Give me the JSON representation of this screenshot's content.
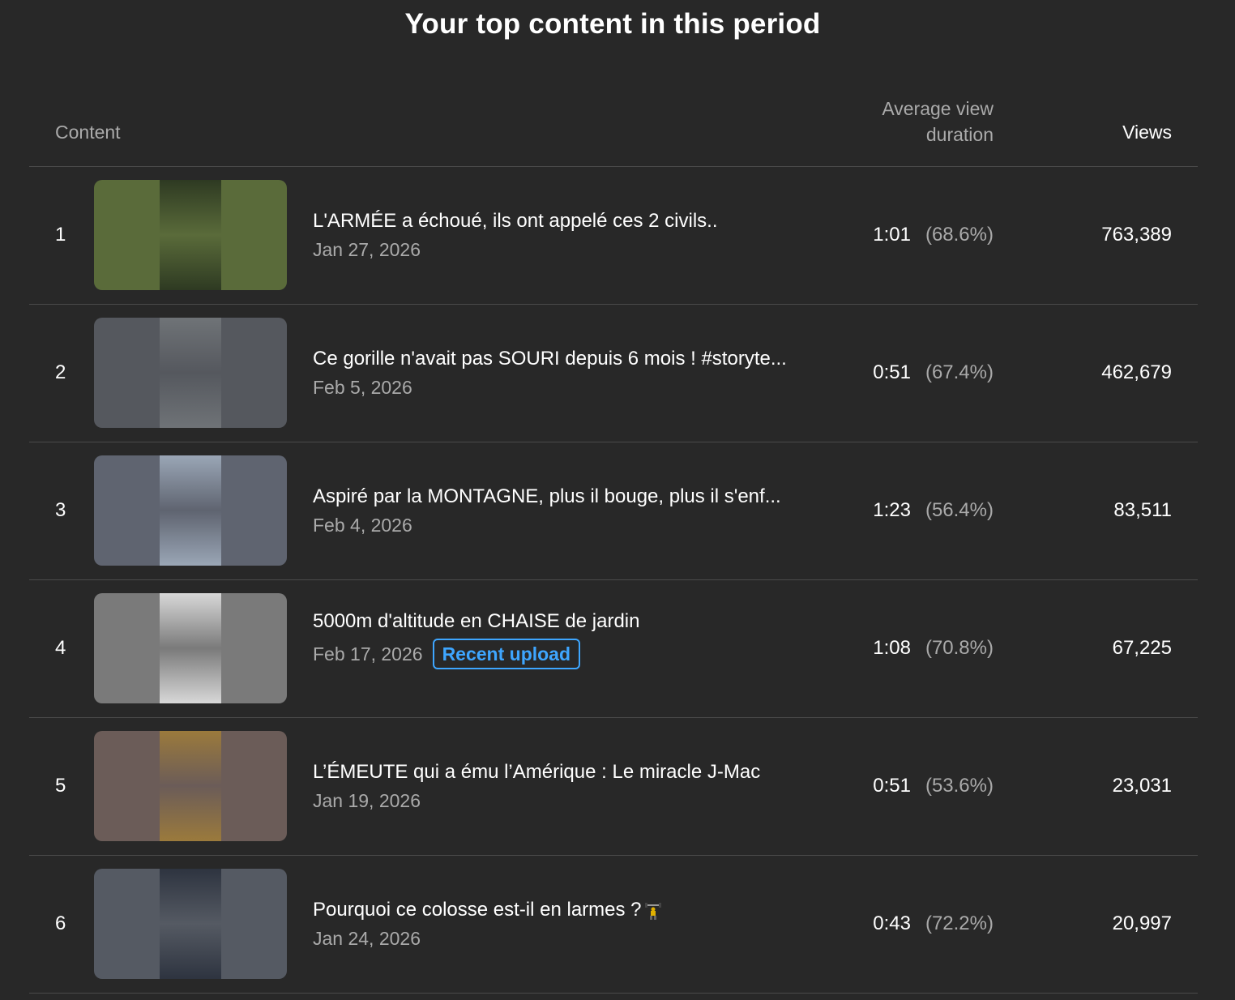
{
  "title": "Your top content in this period",
  "columns": {
    "content": "Content",
    "avd_line1": "Average view",
    "avd_line2": "duration",
    "views": "Views"
  },
  "rows": [
    {
      "rank": "1",
      "title": "L'ARMÉE a échoué, ils ont appelé ces 2 civils..",
      "date": "Jan 27, 2026",
      "avd": "1:01",
      "pct": "(68.6%)",
      "views": "763,389",
      "badge": "",
      "thumb_bg": "#5a6b3a",
      "thumb_fg": "#2e3a22"
    },
    {
      "rank": "2",
      "title": "Ce gorille n'avait pas SOURI depuis 6 mois ! #storyte...",
      "date": "Feb 5, 2026",
      "avd": "0:51",
      "pct": "(67.4%)",
      "views": "462,679",
      "badge": "",
      "thumb_bg": "#55585e",
      "thumb_fg": "#6f7377"
    },
    {
      "rank": "3",
      "title": "Aspiré par la MONTAGNE, plus il bouge, plus il s'enf...",
      "date": "Feb 4, 2026",
      "avd": "1:23",
      "pct": "(56.4%)",
      "views": "83,511",
      "badge": "",
      "thumb_bg": "#5f6470",
      "thumb_fg": "#9aa6b6"
    },
    {
      "rank": "4",
      "title": "5000m d'altitude en CHAISE de jardin",
      "date": "Feb 17, 2026",
      "avd": "1:08",
      "pct": "(70.8%)",
      "views": "67,225",
      "badge": "Recent upload",
      "thumb_bg": "#7a7a7a",
      "thumb_fg": "#d8d8d8"
    },
    {
      "rank": "5",
      "title": "L’ÉMEUTE qui a ému l’Amérique : Le miracle J-Mac",
      "date": "Jan 19, 2026",
      "avd": "0:51",
      "pct": "(53.6%)",
      "views": "23,031",
      "badge": "",
      "thumb_bg": "#6b5c58",
      "thumb_fg": "#9b7a3c"
    },
    {
      "rank": "6",
      "title": "Pourquoi ce colosse est-il en larmes ?",
      "date": "Jan 24, 2026",
      "avd": "0:43",
      "pct": "(72.2%)",
      "views": "20,997",
      "badge": "",
      "trophy": true,
      "thumb_bg": "#555a63",
      "thumb_fg": "#2e3440"
    }
  ]
}
